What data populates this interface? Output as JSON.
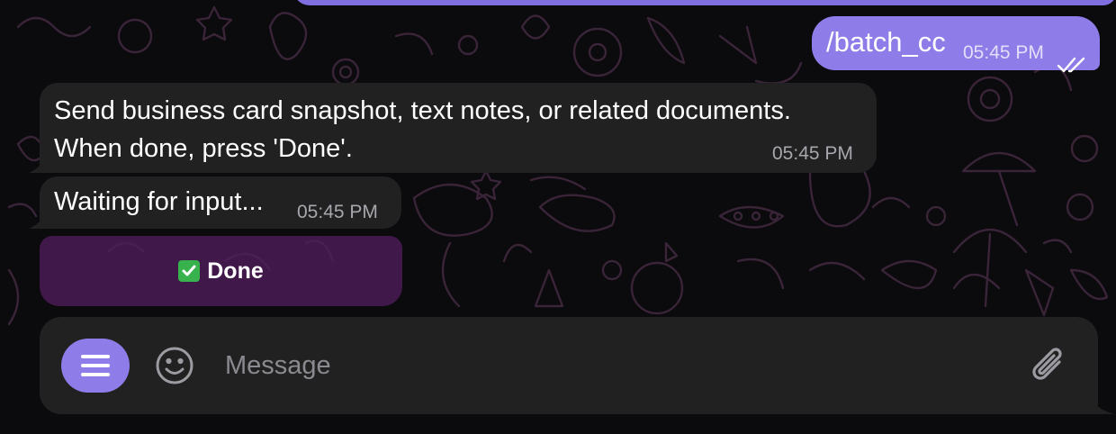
{
  "colors": {
    "background": "#0b0a0d",
    "outgoing_bubble": "#8e7ce8",
    "incoming_bubble": "#212121",
    "keyboard_button": "#4f1e5c",
    "accent": "#8e7ce8"
  },
  "messages": [
    {
      "direction": "outgoing",
      "text": "/batch_cc",
      "time": "05:45 PM",
      "status_icon": "double-check-icon"
    },
    {
      "direction": "incoming",
      "lines": [
        "Send business card snapshot, text notes, or related documents.",
        "When done, press 'Done'."
      ],
      "time": "05:45 PM"
    },
    {
      "direction": "incoming",
      "text": "Waiting for input...",
      "time": "05:45 PM"
    }
  ],
  "inline_keyboard": {
    "buttons": [
      {
        "icon": "check-mark-button-icon",
        "label": "Done"
      }
    ]
  },
  "composer": {
    "menu_icon": "hamburger-menu-icon",
    "emoji_icon": "smiley-icon",
    "placeholder": "Message",
    "value": "",
    "attach_icon": "paperclip-icon"
  }
}
